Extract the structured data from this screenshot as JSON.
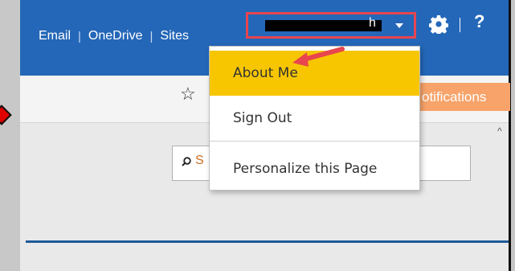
{
  "topbar": {
    "links": [
      "Email",
      "OneDrive",
      "Sites"
    ],
    "user_name_visible": "h",
    "help_label": "?"
  },
  "ribbon": {
    "notifications_label": "otifications"
  },
  "search": {
    "placeholder_visible": "S"
  },
  "user_menu": {
    "items": [
      "About Me",
      "Sign Out",
      "Personalize this Page"
    ]
  },
  "colors": {
    "topbar": "#2467b8",
    "highlight": "#f7c600",
    "annotation": "#e8454e",
    "notifications": "#f7a36a"
  },
  "icons": [
    "gear-icon",
    "help-icon",
    "star-icon",
    "search-icon",
    "caret-down-icon",
    "annotation-arrow-icon",
    "scroll-up-arrow-icon"
  ]
}
